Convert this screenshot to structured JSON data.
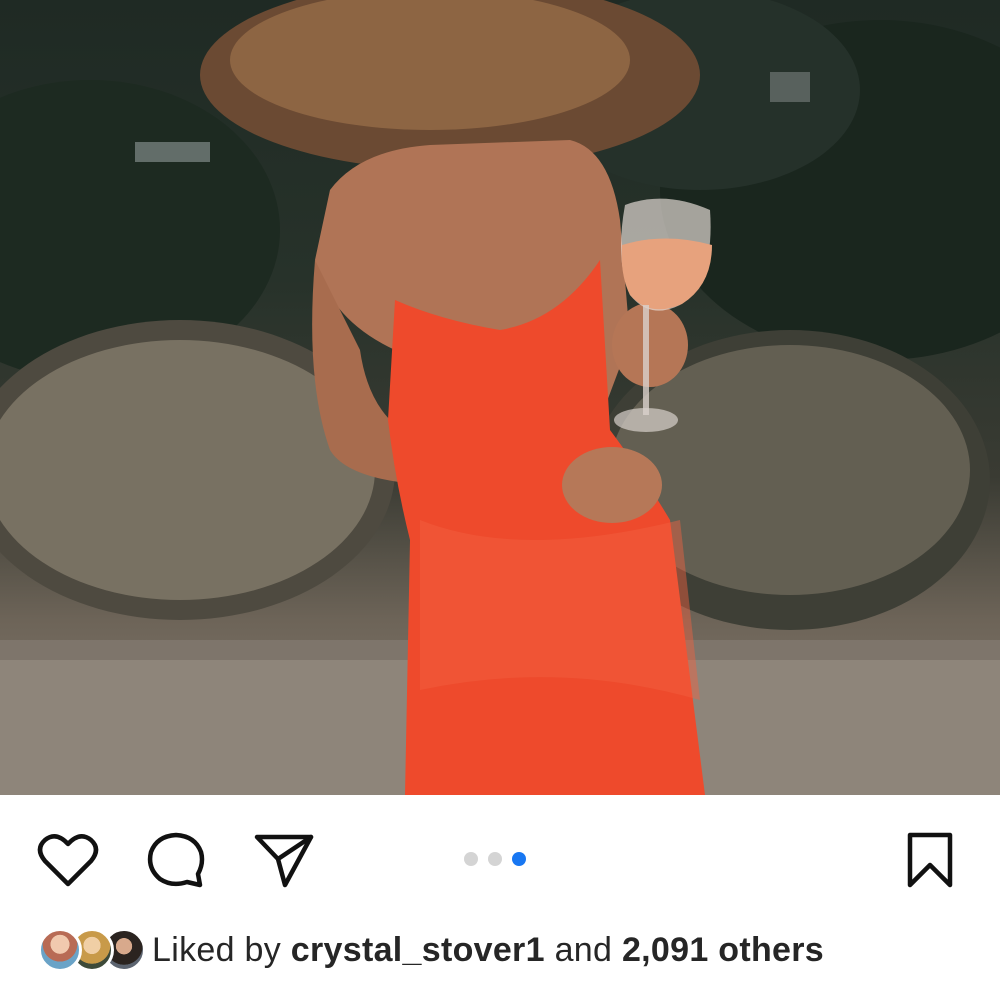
{
  "post": {
    "carousel": {
      "slide_count": 3,
      "active_index": 2
    },
    "likes": {
      "prefix": "Liked by",
      "user": "crystal_stover1",
      "conjunction": "and",
      "count": "2,091 others"
    }
  },
  "icons": {
    "like": "heart-outline-icon",
    "comment": "speech-bubble-icon",
    "share": "paper-plane-icon",
    "save": "bookmark-outline-icon"
  },
  "colors": {
    "text": "#262626",
    "dot_active": "#1877f2",
    "dot_inactive": "#d4d4d4",
    "dress": "#ee4a2c"
  }
}
